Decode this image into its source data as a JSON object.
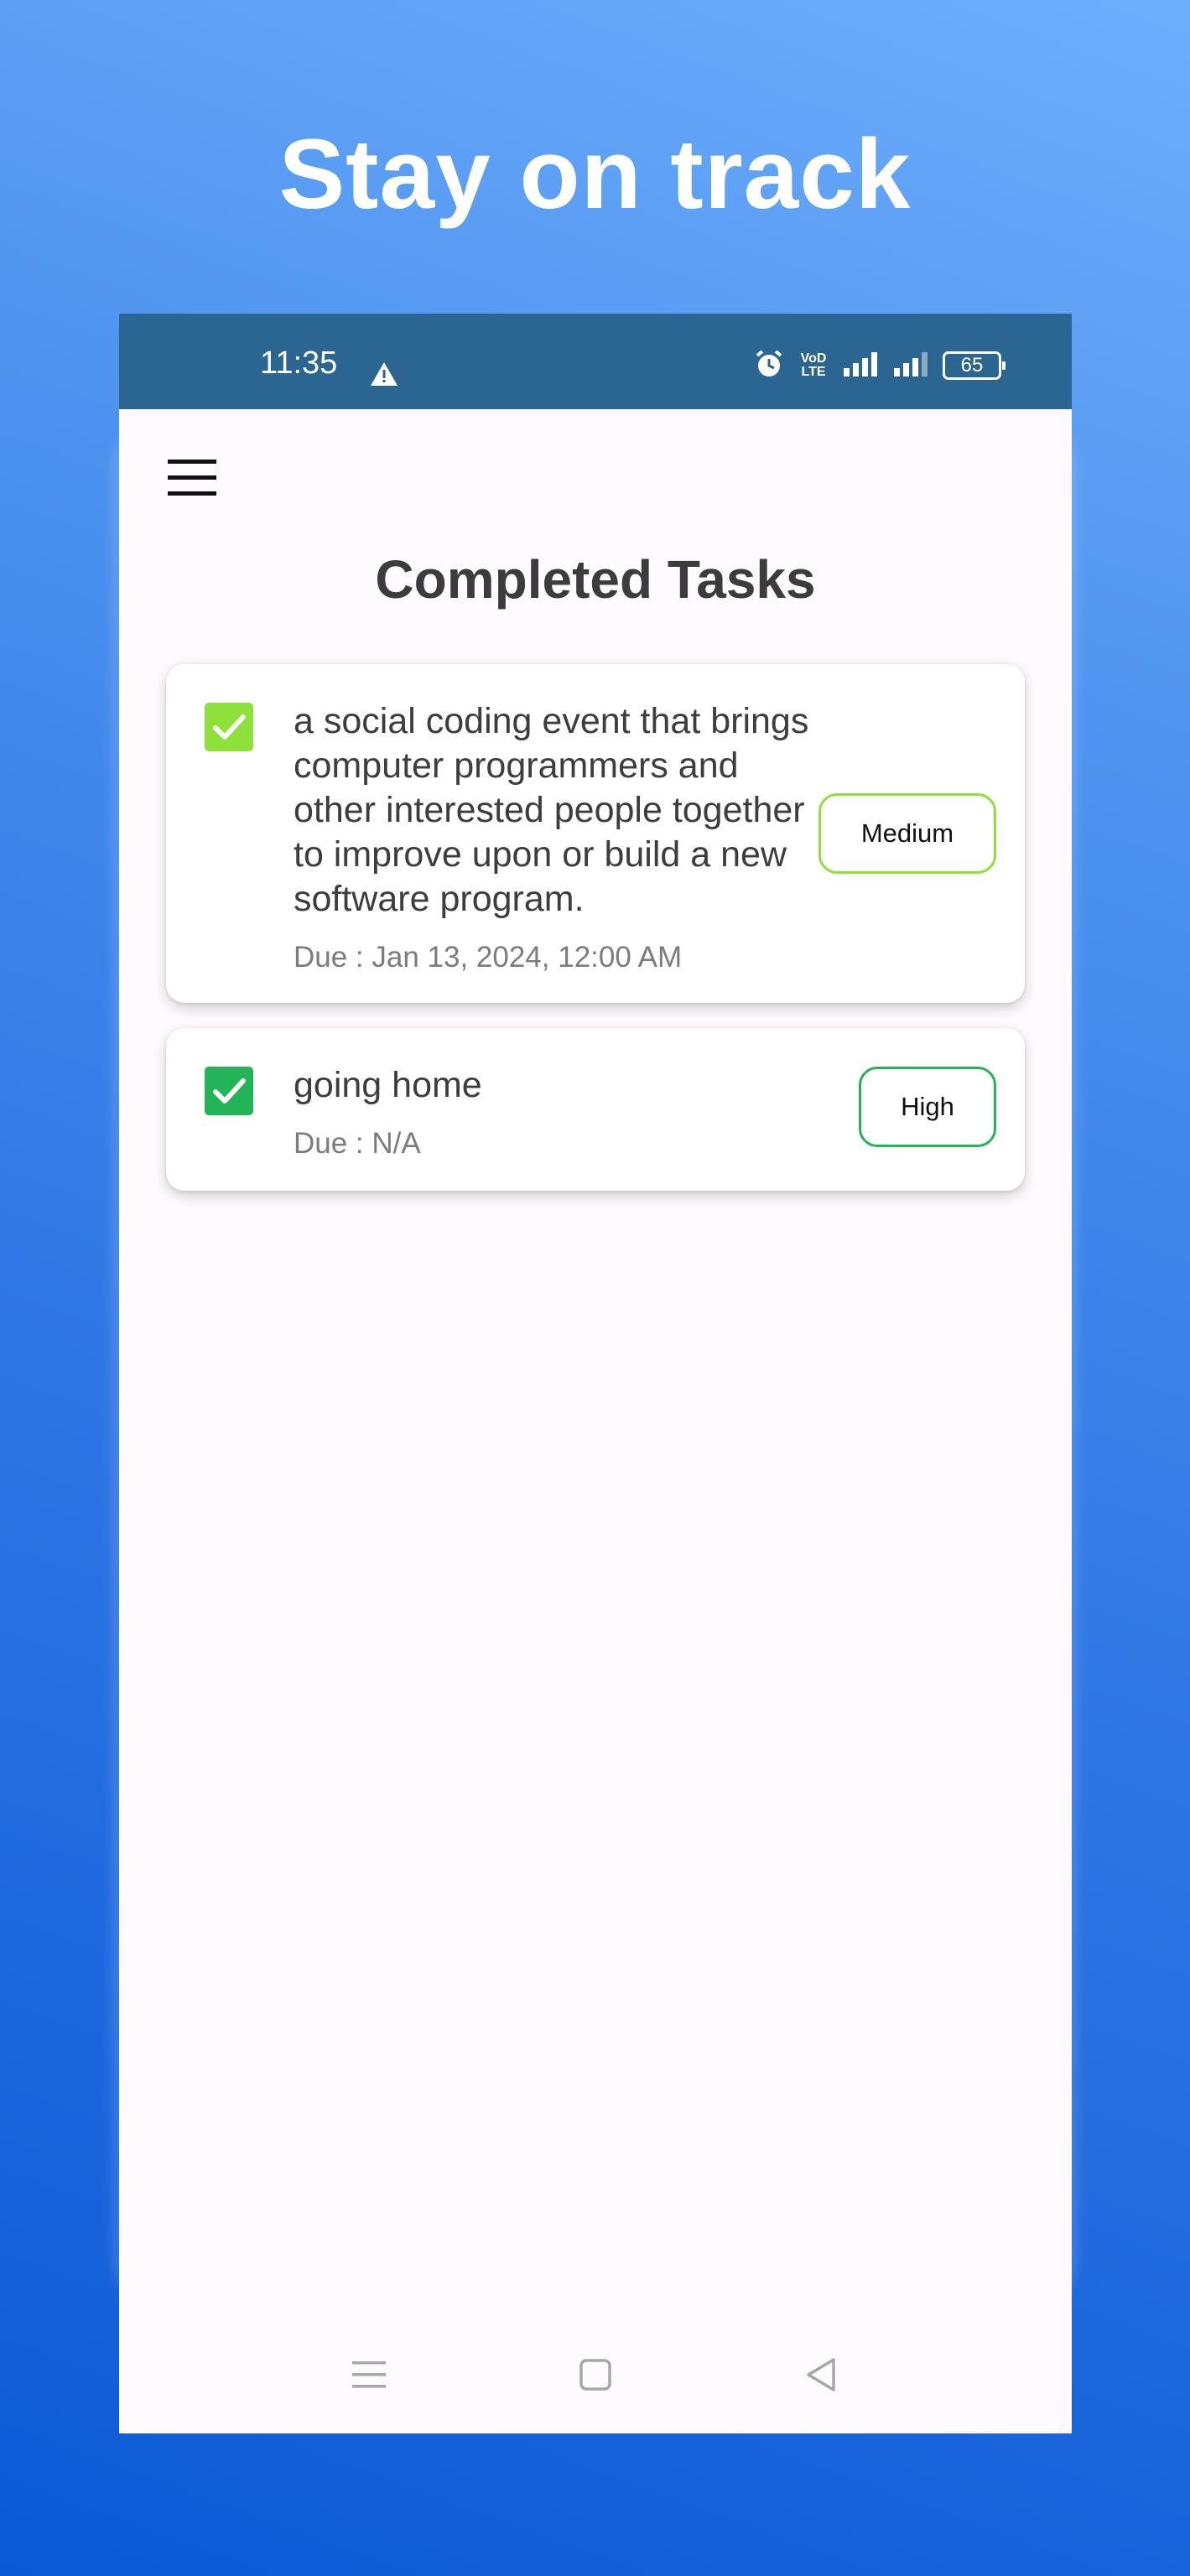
{
  "headline": "Stay on track",
  "status_bar": {
    "time": "11:35",
    "network_label": "VoLTE",
    "volte_top": "VoD",
    "volte_bottom": "LTE",
    "battery": "65"
  },
  "page": {
    "title": "Completed Tasks"
  },
  "tasks": [
    {
      "text": "a social coding event that brings computer programmers and other interested people together to improve upon or build a new software program.",
      "due": "Due : Jan 13, 2024, 12:00 AM",
      "priority": "Medium",
      "priority_color": "#8ee03a",
      "checked": true
    },
    {
      "text": "going home",
      "due": "Due : N/A",
      "priority": "High",
      "priority_color": "#22b457",
      "checked": true
    }
  ],
  "colors": {
    "status_bar": "#2b6592",
    "checkbox_medium": "#8ee03a",
    "checkbox_high": "#22b457",
    "title_text": "#3c3c40"
  },
  "icons": {
    "menu": "hamburger-menu-icon",
    "warning": "warning-icon",
    "alarm": "alarm-icon",
    "signal": "signal-icon",
    "battery": "battery-icon",
    "nav_recents": "recents-icon",
    "nav_home": "home-icon",
    "nav_back": "back-icon"
  }
}
